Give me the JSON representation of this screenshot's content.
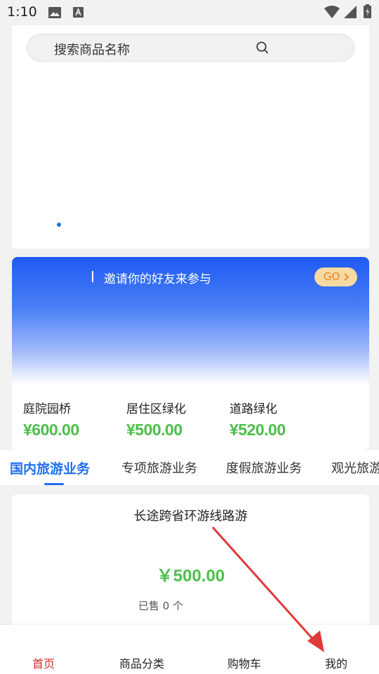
{
  "status_bar": {
    "time": "1:10",
    "icons": [
      "image-icon",
      "text-icon",
      "wifi-icon",
      "signal-icon",
      "battery-icon"
    ]
  },
  "search": {
    "placeholder": "搜索商品名称",
    "icon": "search-icon"
  },
  "carousel": {
    "page_count": 1,
    "active_index": 0
  },
  "invite": {
    "text": "邀请你的好友来参与",
    "go_label": "GO",
    "go_icon": "chevron-right-icon"
  },
  "features": [
    {
      "name": "庭院园桥",
      "price": "¥600.00"
    },
    {
      "name": "居住区绿化",
      "price": "¥500.00"
    },
    {
      "name": "道路绿化",
      "price": "¥520.00"
    }
  ],
  "tabs": [
    {
      "label": "国内旅游业务",
      "active": true
    },
    {
      "label": "专项旅游业务",
      "active": false
    },
    {
      "label": "度假旅游业务",
      "active": false
    },
    {
      "label": "观光旅游",
      "active": false
    }
  ],
  "product": {
    "title": "长途跨省环游线路游",
    "price": "￥500.00",
    "sold": "已售 0 个"
  },
  "bottom_nav": [
    {
      "label": "首页",
      "active": true
    },
    {
      "label": "商品分类",
      "active": false
    },
    {
      "label": "购物车",
      "active": false
    },
    {
      "label": "我的",
      "active": false
    }
  ],
  "colors": {
    "accent_blue": "#1f6ff0",
    "price_green": "#4cbf4a",
    "nav_active_red": "#d02a2a",
    "go_button_bg": "#f7d9a4",
    "annotation_arrow": "#e03a3a"
  }
}
